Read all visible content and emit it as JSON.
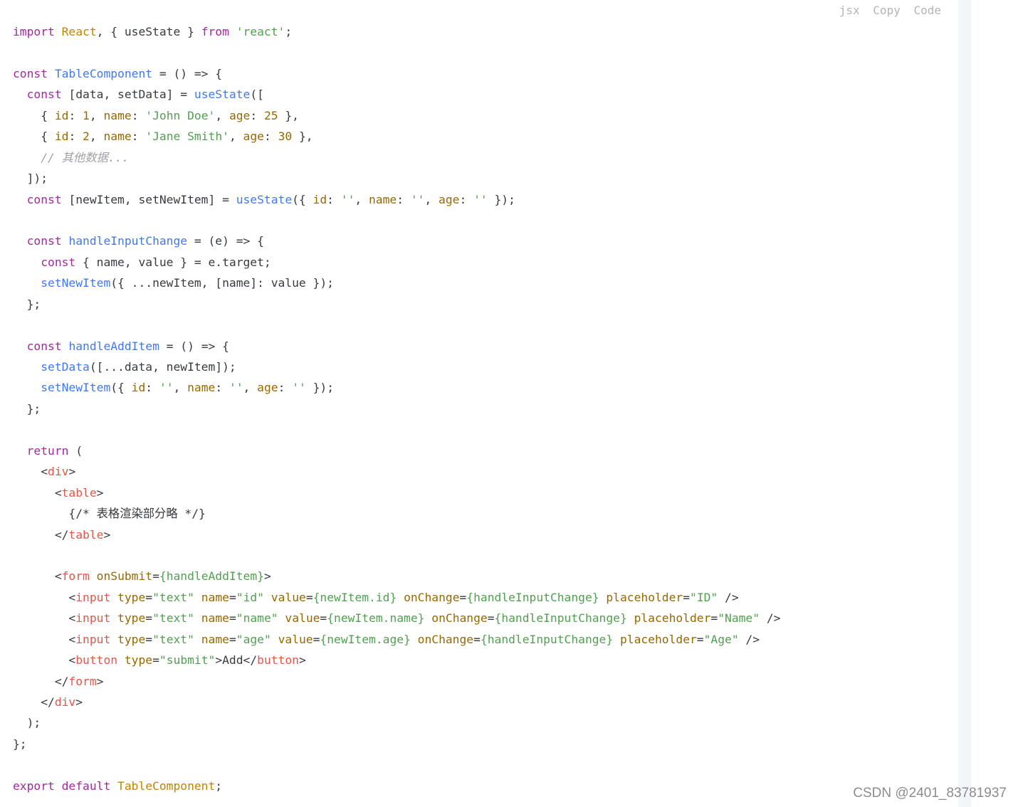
{
  "toolbar": {
    "language": "jsx",
    "copy_label": "Copy",
    "code_label": "Code"
  },
  "watermark": "CSDN @2401_83781937",
  "colors": {
    "keyword": "#a626a4",
    "type": "#c18401",
    "function": "#4078f2",
    "string": "#50a14f",
    "number": "#986801",
    "tag": "#e45649",
    "comment": "#a0a1a7",
    "plain": "#383a42"
  },
  "code_lines": [
    [
      [
        "kw",
        "import "
      ],
      [
        "ty",
        "React"
      ],
      [
        "pl",
        ", { useState } "
      ],
      [
        "kw",
        "from "
      ],
      [
        "str",
        "'react'"
      ],
      [
        "pl",
        ";"
      ]
    ],
    [],
    [
      [
        "kw",
        "const "
      ],
      [
        "fn",
        "TableComponent"
      ],
      [
        "pl",
        " = () => {"
      ]
    ],
    [
      [
        "pl",
        "  "
      ],
      [
        "kw",
        "const "
      ],
      [
        "pl",
        "[data, setData] = "
      ],
      [
        "fn",
        "useState"
      ],
      [
        "pl",
        "(["
      ]
    ],
    [
      [
        "pl",
        "    { "
      ],
      [
        "prop",
        "id"
      ],
      [
        "pl",
        ": "
      ],
      [
        "num",
        "1"
      ],
      [
        "pl",
        ", "
      ],
      [
        "prop",
        "name"
      ],
      [
        "pl",
        ": "
      ],
      [
        "str",
        "'John Doe'"
      ],
      [
        "pl",
        ", "
      ],
      [
        "prop",
        "age"
      ],
      [
        "pl",
        ": "
      ],
      [
        "num",
        "25"
      ],
      [
        "pl",
        " },"
      ]
    ],
    [
      [
        "pl",
        "    { "
      ],
      [
        "prop",
        "id"
      ],
      [
        "pl",
        ": "
      ],
      [
        "num",
        "2"
      ],
      [
        "pl",
        ", "
      ],
      [
        "prop",
        "name"
      ],
      [
        "pl",
        ": "
      ],
      [
        "str",
        "'Jane Smith'"
      ],
      [
        "pl",
        ", "
      ],
      [
        "prop",
        "age"
      ],
      [
        "pl",
        ": "
      ],
      [
        "num",
        "30"
      ],
      [
        "pl",
        " },"
      ]
    ],
    [
      [
        "pl",
        "    "
      ],
      [
        "com",
        "// 其他数据..."
      ]
    ],
    [
      [
        "pl",
        "  ]);"
      ]
    ],
    [
      [
        "pl",
        "  "
      ],
      [
        "kw",
        "const "
      ],
      [
        "pl",
        "[newItem, setNewItem] = "
      ],
      [
        "fn",
        "useState"
      ],
      [
        "pl",
        "({ "
      ],
      [
        "prop",
        "id"
      ],
      [
        "pl",
        ": "
      ],
      [
        "str",
        "''"
      ],
      [
        "pl",
        ", "
      ],
      [
        "prop",
        "name"
      ],
      [
        "pl",
        ": "
      ],
      [
        "str",
        "''"
      ],
      [
        "pl",
        ", "
      ],
      [
        "prop",
        "age"
      ],
      [
        "pl",
        ": "
      ],
      [
        "str",
        "''"
      ],
      [
        "pl",
        " });"
      ]
    ],
    [],
    [
      [
        "pl",
        "  "
      ],
      [
        "kw",
        "const "
      ],
      [
        "fn",
        "handleInputChange"
      ],
      [
        "pl",
        " = (e) => {"
      ]
    ],
    [
      [
        "pl",
        "    "
      ],
      [
        "kw",
        "const "
      ],
      [
        "pl",
        "{ name, value } = e.target;"
      ]
    ],
    [
      [
        "pl",
        "    "
      ],
      [
        "fn",
        "setNewItem"
      ],
      [
        "pl",
        "({ ...newItem, [name]: value });"
      ]
    ],
    [
      [
        "pl",
        "  };"
      ]
    ],
    [],
    [
      [
        "pl",
        "  "
      ],
      [
        "kw",
        "const "
      ],
      [
        "fn",
        "handleAddItem"
      ],
      [
        "pl",
        " = () => {"
      ]
    ],
    [
      [
        "pl",
        "    "
      ],
      [
        "fn",
        "setData"
      ],
      [
        "pl",
        "([...data, newItem]);"
      ]
    ],
    [
      [
        "pl",
        "    "
      ],
      [
        "fn",
        "setNewItem"
      ],
      [
        "pl",
        "({ "
      ],
      [
        "prop",
        "id"
      ],
      [
        "pl",
        ": "
      ],
      [
        "str",
        "''"
      ],
      [
        "pl",
        ", "
      ],
      [
        "prop",
        "name"
      ],
      [
        "pl",
        ": "
      ],
      [
        "str",
        "''"
      ],
      [
        "pl",
        ", "
      ],
      [
        "prop",
        "age"
      ],
      [
        "pl",
        ": "
      ],
      [
        "str",
        "''"
      ],
      [
        "pl",
        " });"
      ]
    ],
    [
      [
        "pl",
        "  };"
      ]
    ],
    [],
    [
      [
        "pl",
        "  "
      ],
      [
        "kw",
        "return "
      ],
      [
        "pl",
        "("
      ]
    ],
    [
      [
        "pl",
        "    <"
      ],
      [
        "tag",
        "div"
      ],
      [
        "pl",
        ">"
      ]
    ],
    [
      [
        "pl",
        "      <"
      ],
      [
        "tag",
        "table"
      ],
      [
        "pl",
        ">"
      ]
    ],
    [
      [
        "pl",
        "        {/* 表格渲染部分略 */}"
      ]
    ],
    [
      [
        "pl",
        "      </"
      ],
      [
        "tag",
        "table"
      ],
      [
        "pl",
        ">"
      ]
    ],
    [],
    [
      [
        "pl",
        "      <"
      ],
      [
        "tag",
        "form"
      ],
      [
        "pl",
        " "
      ],
      [
        "attr",
        "onSubmit"
      ],
      [
        "pl",
        "="
      ],
      [
        "str",
        "{handleAddItem}"
      ],
      [
        "pl",
        ">"
      ]
    ],
    [
      [
        "pl",
        "        <"
      ],
      [
        "tag",
        "input"
      ],
      [
        "pl",
        " "
      ],
      [
        "attr",
        "type"
      ],
      [
        "pl",
        "="
      ],
      [
        "str",
        "\"text\""
      ],
      [
        "pl",
        " "
      ],
      [
        "attr",
        "name"
      ],
      [
        "pl",
        "="
      ],
      [
        "str",
        "\"id\""
      ],
      [
        "pl",
        " "
      ],
      [
        "attr",
        "value"
      ],
      [
        "pl",
        "="
      ],
      [
        "str",
        "{newItem.id}"
      ],
      [
        "pl",
        " "
      ],
      [
        "attr",
        "onChange"
      ],
      [
        "pl",
        "="
      ],
      [
        "str",
        "{handleInputChange}"
      ],
      [
        "pl",
        " "
      ],
      [
        "attr",
        "placeholder"
      ],
      [
        "pl",
        "="
      ],
      [
        "str",
        "\"ID\""
      ],
      [
        "pl",
        " />"
      ]
    ],
    [
      [
        "pl",
        "        <"
      ],
      [
        "tag",
        "input"
      ],
      [
        "pl",
        " "
      ],
      [
        "attr",
        "type"
      ],
      [
        "pl",
        "="
      ],
      [
        "str",
        "\"text\""
      ],
      [
        "pl",
        " "
      ],
      [
        "attr",
        "name"
      ],
      [
        "pl",
        "="
      ],
      [
        "str",
        "\"name\""
      ],
      [
        "pl",
        " "
      ],
      [
        "attr",
        "value"
      ],
      [
        "pl",
        "="
      ],
      [
        "str",
        "{newItem.name}"
      ],
      [
        "pl",
        " "
      ],
      [
        "attr",
        "onChange"
      ],
      [
        "pl",
        "="
      ],
      [
        "str",
        "{handleInputChange}"
      ],
      [
        "pl",
        " "
      ],
      [
        "attr",
        "placeholder"
      ],
      [
        "pl",
        "="
      ],
      [
        "str",
        "\"Name\""
      ],
      [
        "pl",
        " />"
      ]
    ],
    [
      [
        "pl",
        "        <"
      ],
      [
        "tag",
        "input"
      ],
      [
        "pl",
        " "
      ],
      [
        "attr",
        "type"
      ],
      [
        "pl",
        "="
      ],
      [
        "str",
        "\"text\""
      ],
      [
        "pl",
        " "
      ],
      [
        "attr",
        "name"
      ],
      [
        "pl",
        "="
      ],
      [
        "str",
        "\"age\""
      ],
      [
        "pl",
        " "
      ],
      [
        "attr",
        "value"
      ],
      [
        "pl",
        "="
      ],
      [
        "str",
        "{newItem.age}"
      ],
      [
        "pl",
        " "
      ],
      [
        "attr",
        "onChange"
      ],
      [
        "pl",
        "="
      ],
      [
        "str",
        "{handleInputChange}"
      ],
      [
        "pl",
        " "
      ],
      [
        "attr",
        "placeholder"
      ],
      [
        "pl",
        "="
      ],
      [
        "str",
        "\"Age\""
      ],
      [
        "pl",
        " />"
      ]
    ],
    [
      [
        "pl",
        "        <"
      ],
      [
        "tag",
        "button"
      ],
      [
        "pl",
        " "
      ],
      [
        "attr",
        "type"
      ],
      [
        "pl",
        "="
      ],
      [
        "str",
        "\"submit\""
      ],
      [
        "pl",
        ">Add</"
      ],
      [
        "tag",
        "button"
      ],
      [
        "pl",
        ">"
      ]
    ],
    [
      [
        "pl",
        "      </"
      ],
      [
        "tag",
        "form"
      ],
      [
        "pl",
        ">"
      ]
    ],
    [
      [
        "pl",
        "    </"
      ],
      [
        "tag",
        "div"
      ],
      [
        "pl",
        ">"
      ]
    ],
    [
      [
        "pl",
        "  );"
      ]
    ],
    [
      [
        "pl",
        "};"
      ]
    ],
    [],
    [
      [
        "kw",
        "export "
      ],
      [
        "kw",
        "default "
      ],
      [
        "ty",
        "TableComponent"
      ],
      [
        "pl",
        ";"
      ]
    ]
  ]
}
